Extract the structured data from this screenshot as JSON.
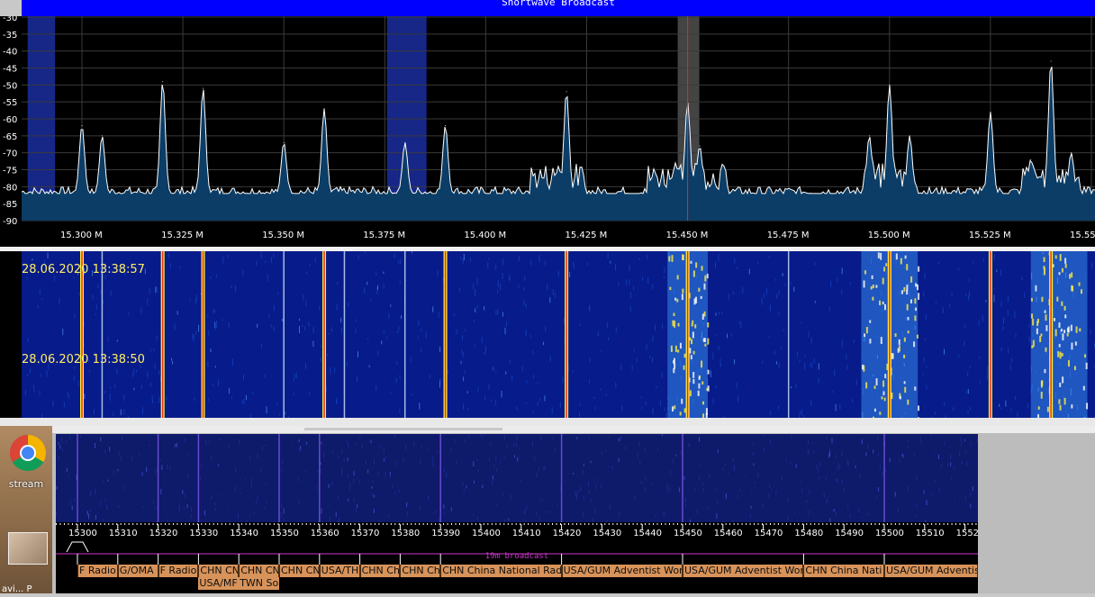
{
  "band_title": "Shortwave Broadcast",
  "spectrum": {
    "db_ticks": [
      "-30",
      "-35",
      "-40",
      "-45",
      "-50",
      "-55",
      "-60",
      "-65",
      "-70",
      "-75",
      "-80",
      "-85",
      "-90"
    ],
    "freq_ticks": [
      "15.300 M",
      "15.325 M",
      "15.350 M",
      "15.375 M",
      "15.400 M",
      "15.425 M",
      "15.450 M",
      "15.475 M",
      "15.500 M",
      "15.525 M",
      "15.55"
    ],
    "peaks": [
      {
        "f": 15.3,
        "db": -62
      },
      {
        "f": 15.305,
        "db": -65
      },
      {
        "f": 15.32,
        "db": -49
      },
      {
        "f": 15.33,
        "db": -51
      },
      {
        "f": 15.35,
        "db": -67
      },
      {
        "f": 15.36,
        "db": -57
      },
      {
        "f": 15.38,
        "db": -67
      },
      {
        "f": 15.39,
        "db": -62
      },
      {
        "f": 15.418,
        "db": -74
      },
      {
        "f": 15.42,
        "db": -52
      },
      {
        "f": 15.447,
        "db": -73
      },
      {
        "f": 15.45,
        "db": -55
      },
      {
        "f": 15.453,
        "db": -68
      },
      {
        "f": 15.495,
        "db": -65
      },
      {
        "f": 15.5,
        "db": -50
      },
      {
        "f": 15.505,
        "db": -65
      },
      {
        "f": 15.525,
        "db": -58
      },
      {
        "f": 15.535,
        "db": -72
      },
      {
        "f": 15.54,
        "db": -43
      },
      {
        "f": 15.545,
        "db": -70
      }
    ],
    "bands_highlight": [
      {
        "from": 15.287,
        "to": 15.292
      },
      {
        "from": 15.376,
        "to": 15.384
      }
    ],
    "tuned_freq": 15.45,
    "colors": {
      "fill": "#0b3d66",
      "trace": "#ffffff",
      "grid": "#3a3a3a",
      "marker": "#ff2020",
      "highlight": "#1a2ea0"
    }
  },
  "waterfall": {
    "timestamps": [
      "28.06.2020 13:38:57",
      "28.06.2020 13:38:50"
    ],
    "strong_lines": [
      15.3,
      15.32,
      15.33,
      15.36,
      15.39,
      15.42,
      15.45,
      15.5,
      15.525,
      15.54
    ],
    "wide_signals": [
      {
        "from": 15.445,
        "to": 15.455
      },
      {
        "from": 15.493,
        "to": 15.507
      },
      {
        "from": 15.535,
        "to": 15.549
      }
    ],
    "weak_lines": [
      15.305,
      15.35,
      15.365,
      15.38,
      15.475
    ],
    "colors": {
      "bg": "#071b8a",
      "strong": "#ffee44",
      "core": "#e83010",
      "mid": "#3fa0ff"
    }
  },
  "desktop": {
    "icon1_label": "stream",
    "icon2_label": "avi... P"
  },
  "mini": {
    "freq_ticks": [
      "15300",
      "15310",
      "15320",
      "15330",
      "15340",
      "15350",
      "15360",
      "15370",
      "15380",
      "15390",
      "15400",
      "15410",
      "15420",
      "15430",
      "15440",
      "15450",
      "15460",
      "15470",
      "15480",
      "15490",
      "15500",
      "15510",
      "1552"
    ],
    "band_label": "19m broadcast",
    "stations_row1": [
      {
        "label": "F Radio",
        "f1": 15300,
        "f2": 15310
      },
      {
        "label": "G/OMA",
        "f1": 15310,
        "f2": 15320
      },
      {
        "label": "F Radio",
        "f1": 15320,
        "f2": 15330
      },
      {
        "label": "CHN CN",
        "f1": 15330,
        "f2": 15340
      },
      {
        "label": "CHN CN",
        "f1": 15340,
        "f2": 15350
      },
      {
        "label": "CHN CN",
        "f1": 15350,
        "f2": 15360
      },
      {
        "label": "USA/TH",
        "f1": 15360,
        "f2": 15370
      },
      {
        "label": "CHN Ch",
        "f1": 15370,
        "f2": 15380
      },
      {
        "label": "CHN Ch",
        "f1": 15380,
        "f2": 15390
      },
      {
        "label": "CHN China National Rad",
        "f1": 15390,
        "f2": 15420
      },
      {
        "label": "USA/GUM Adventist Wor",
        "f1": 15420,
        "f2": 15450
      },
      {
        "label": "USA/GUM Adventist Wor",
        "f1": 15450,
        "f2": 15480
      },
      {
        "label": "CHN China Nati",
        "f1": 15480,
        "f2": 15500
      },
      {
        "label": "USA/GUM Adventist World Radio",
        "f1": 15500,
        "f2": 15540
      }
    ],
    "stations_row2": [
      {
        "label": "USA/MF",
        "f1": 15330,
        "f2": 15340
      },
      {
        "label": "TWN So",
        "f1": 15340,
        "f2": 15350
      }
    ],
    "colors": {
      "marker": "#ffffff",
      "band": "#cc33cc",
      "station": "#d8935a"
    }
  }
}
